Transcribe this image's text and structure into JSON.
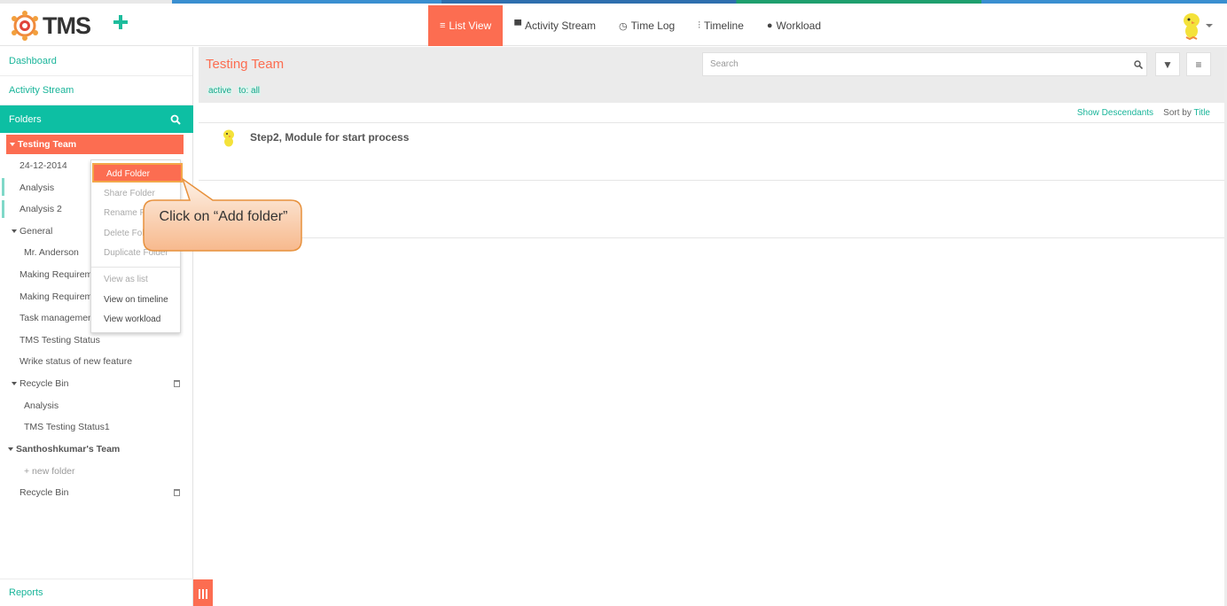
{
  "app": {
    "name": "TMS"
  },
  "nav": {
    "items": [
      {
        "label": "List View",
        "icon": "list-icon",
        "active": true
      },
      {
        "label": "Activity Stream",
        "icon": "comment-icon",
        "active": false
      },
      {
        "label": "Time Log",
        "icon": "clock-icon",
        "active": false
      },
      {
        "label": "Timeline",
        "icon": "sliders-icon",
        "active": false
      },
      {
        "label": "Workload",
        "icon": "user-icon",
        "active": false
      }
    ]
  },
  "sidebar": {
    "dashboard": "Dashboard",
    "activity_stream": "Activity Stream",
    "folders": "Folders",
    "reports": "Reports",
    "tree": [
      {
        "label": "Testing Team"
      },
      {
        "label": "24-12-2014"
      },
      {
        "label": "Analysis"
      },
      {
        "label": "Analysis 2"
      },
      {
        "label": "General"
      },
      {
        "label": "Mr. Anderson"
      },
      {
        "label": "Making Requireme"
      },
      {
        "label": "Making Requireme"
      },
      {
        "label": "Task management"
      },
      {
        "label": "TMS Testing Status"
      },
      {
        "label": "Wrike status of new feature"
      },
      {
        "label": "Recycle Bin"
      },
      {
        "label": "Analysis"
      },
      {
        "label": "TMS Testing Status1"
      },
      {
        "label": "Santhoshkumar's Team"
      },
      {
        "label": "+ new folder"
      },
      {
        "label": "Recycle Bin"
      }
    ]
  },
  "main": {
    "title": "Testing Team",
    "search_placeholder": "Search",
    "tags": [
      "active",
      "to: all"
    ],
    "show_descendants": "Show Descendants",
    "sort_by": "Sort by",
    "sort_field": "Title",
    "tasks": [
      {
        "title": "Step2, Module for start process"
      }
    ]
  },
  "context_menu": {
    "items": [
      {
        "label": "Add Folder",
        "enabled": true,
        "highlighted": true
      },
      {
        "label": "Share Folder",
        "enabled": false
      },
      {
        "label": "Rename Fo",
        "enabled": false
      },
      {
        "label": "Delete Fol",
        "enabled": false
      },
      {
        "label": "Duplicate Folder",
        "enabled": false
      },
      {
        "label": "View as list",
        "enabled": false
      },
      {
        "label": "View on timeline",
        "enabled": true
      },
      {
        "label": "View workload",
        "enabled": true
      }
    ]
  },
  "callout": {
    "text": "Click on “Add folder”"
  },
  "colors": {
    "accent": "#fc6d51",
    "teal": "#0dbfa3",
    "link": "#1ab59a"
  }
}
